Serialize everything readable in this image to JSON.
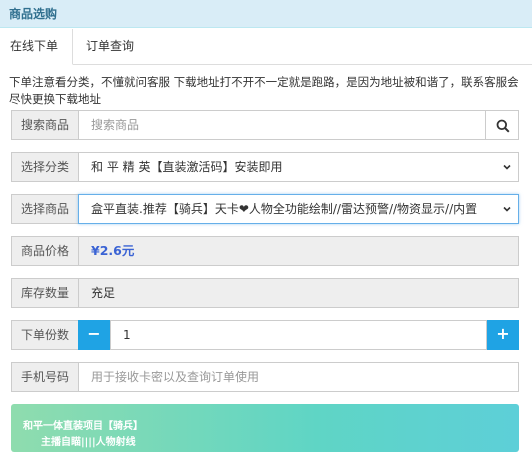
{
  "header": {
    "title": "商品选购"
  },
  "tabs": [
    {
      "label": "在线下单"
    },
    {
      "label": "订单查询"
    }
  ],
  "notice": "下单注意看分类，不懂就问客服 下载地址打不开不一定就是跑路，是因为地址被和谐了，联系客服会尽快更换下载地址",
  "form": {
    "search": {
      "label": "搜索商品",
      "placeholder": "搜索商品",
      "icon": "search-icon"
    },
    "category": {
      "label": "选择分类",
      "value": "和 平 精 英【直装激活码】安装即用"
    },
    "product": {
      "label": "选择商品",
      "value": "盒平直装.推荐【骑兵】天卡❤人物全功能绘制//雷达预警//物资显示//内置"
    },
    "price": {
      "label": "商品价格",
      "value": "¥2.6元"
    },
    "stock": {
      "label": "库存数量",
      "value": "充足"
    },
    "quantity": {
      "label": "下单份数",
      "value": "1",
      "minus": "−",
      "plus": "+"
    },
    "phone": {
      "label": "手机号码",
      "placeholder": "用于接收卡密以及查询订单使用"
    }
  },
  "banner": {
    "line1": "和平一体直装项目【骑兵】",
    "line2": "主播自瞄||||人物射线"
  },
  "colors": {
    "accent": "#1fa3e4",
    "price": "#3a63d4",
    "header_bg": "#d9edf7"
  }
}
